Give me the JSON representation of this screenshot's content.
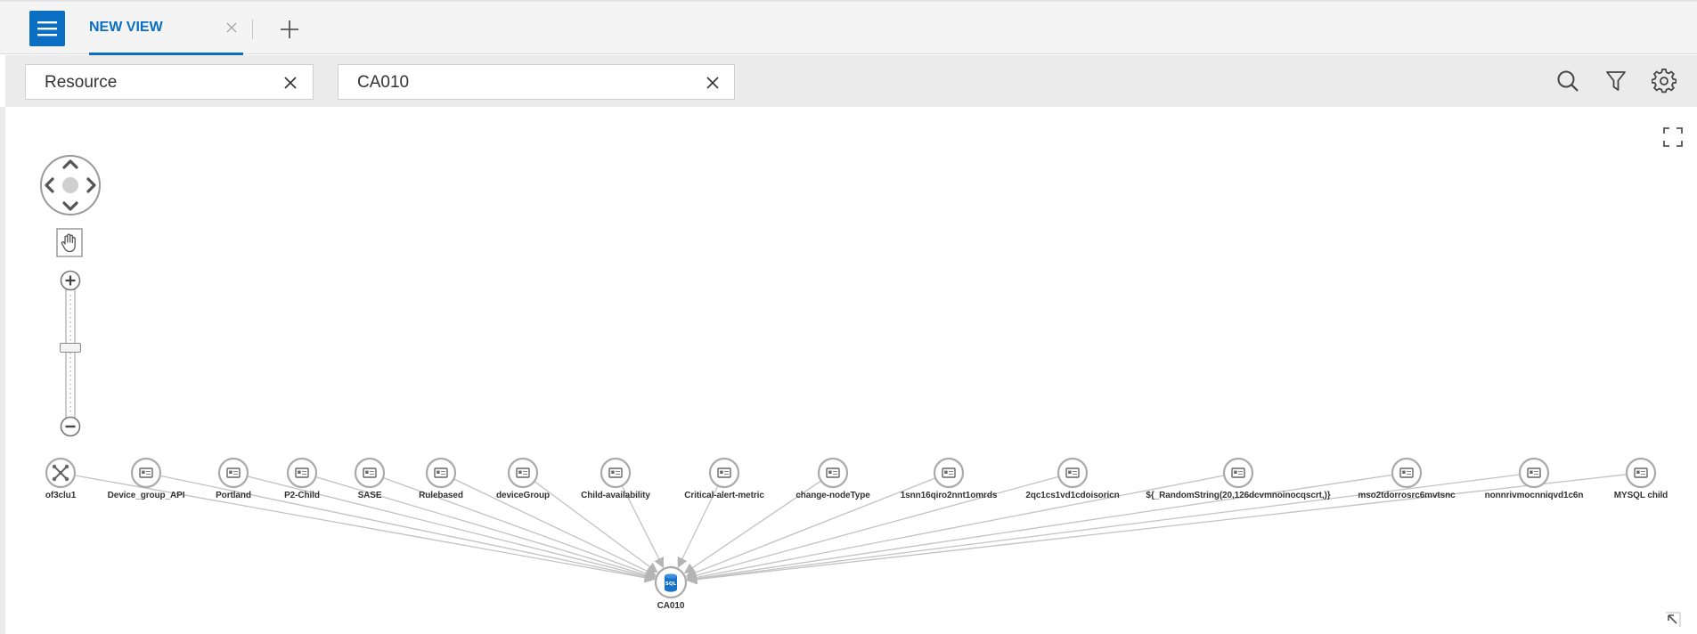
{
  "tabs": [
    {
      "label": "NEW VIEW",
      "active": true
    }
  ],
  "filters": [
    {
      "value": "Resource"
    },
    {
      "value": "CA010"
    }
  ],
  "toolbar_icons": [
    "search-icon",
    "filter-icon",
    "settings-icon"
  ],
  "topology": {
    "target": {
      "label": "CA010",
      "icon": "sql-database-icon"
    },
    "sources": [
      {
        "label": "of3clu1",
        "icon": "cluster-icon"
      },
      {
        "label": "Device_group_API",
        "icon": "device-group-icon"
      },
      {
        "label": "Portland",
        "icon": "device-group-icon"
      },
      {
        "label": "P2-Child",
        "icon": "device-group-icon"
      },
      {
        "label": "SASE",
        "icon": "device-group-icon"
      },
      {
        "label": "Rulebased",
        "icon": "device-group-icon"
      },
      {
        "label": "deviceGroup",
        "icon": "device-group-icon"
      },
      {
        "label": "Child-availability",
        "icon": "device-group-icon"
      },
      {
        "label": "Critical-alert-metric",
        "icon": "device-group-icon"
      },
      {
        "label": "change-nodeType",
        "icon": "device-group-icon"
      },
      {
        "label": "1snn16qiro2nnt1omrds",
        "icon": "device-group-icon"
      },
      {
        "label": "2qc1cs1vd1cdoisoricn",
        "icon": "device-group-icon"
      },
      {
        "label": "${_RandomString(20,126dcvmnoinocqscrt,)}",
        "icon": "device-group-icon"
      },
      {
        "label": "mso2tdorrosrc6mvtsnc",
        "icon": "device-group-icon"
      },
      {
        "label": "nonnrivmocnniqvd1c6n",
        "icon": "device-group-icon"
      },
      {
        "label": "MYSQL child",
        "icon": "device-group-icon"
      }
    ]
  },
  "colors": {
    "accent": "#0a6fc2",
    "edge": "#c2c2c2",
    "node_border": "#aaaaaa",
    "sql_node": "#1a73c8"
  }
}
